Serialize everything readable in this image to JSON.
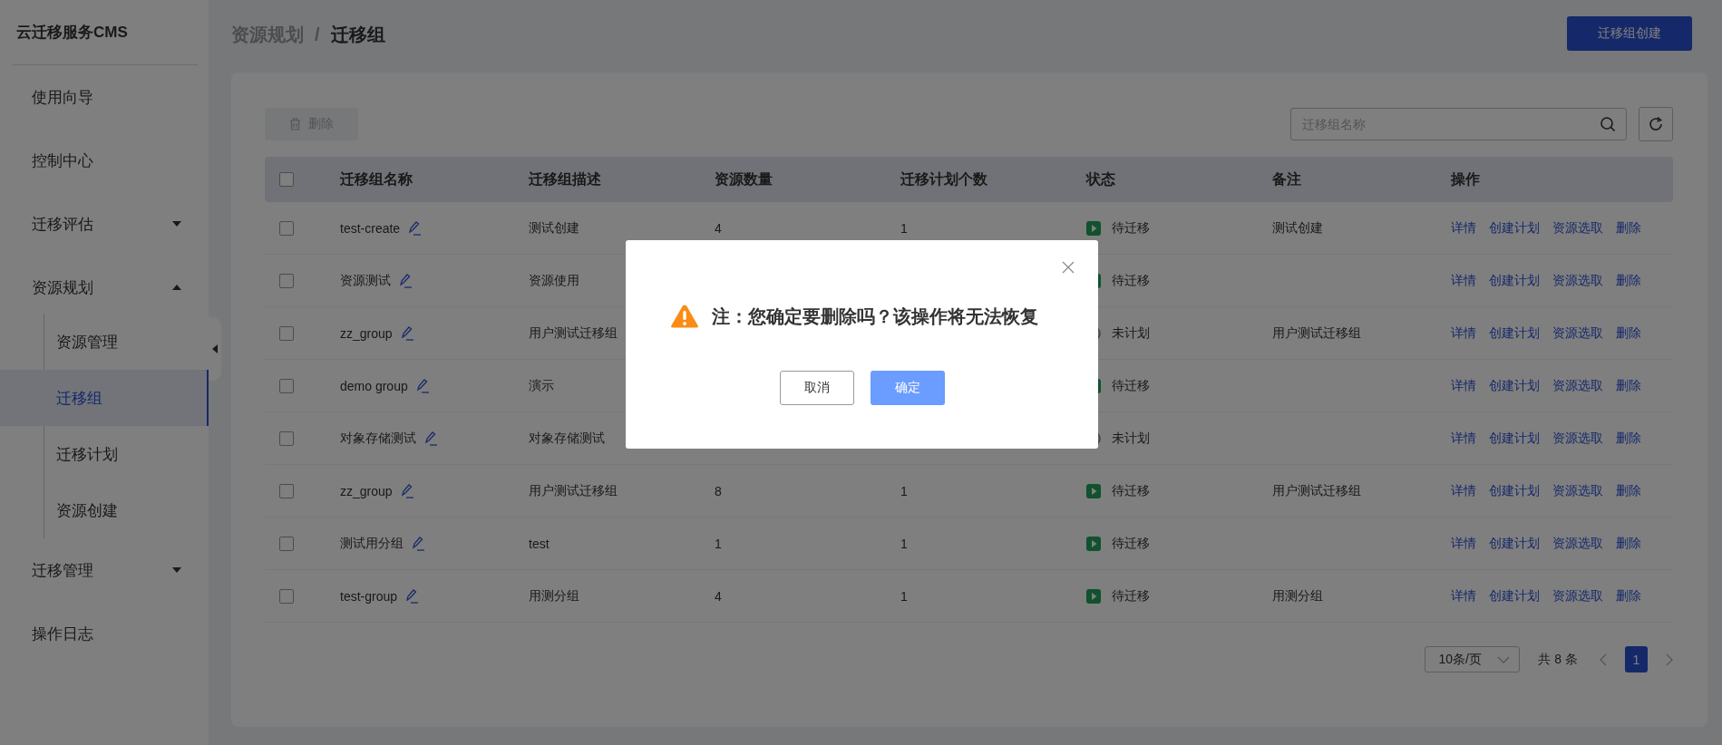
{
  "sidebar": {
    "title": "云迁移服务CMS",
    "items": [
      {
        "label": "使用向导",
        "kind": "item",
        "selected": false
      },
      {
        "label": "控制中心",
        "kind": "item",
        "selected": false
      },
      {
        "label": "迁移评估",
        "kind": "group",
        "expanded": false,
        "selected": false
      },
      {
        "label": "资源规划",
        "kind": "group",
        "expanded": true,
        "selected": false,
        "children": [
          {
            "label": "资源管理",
            "selected": false
          },
          {
            "label": "迁移组",
            "selected": true
          },
          {
            "label": "迁移计划",
            "selected": false
          },
          {
            "label": "资源创建",
            "selected": false
          }
        ]
      },
      {
        "label": "迁移管理",
        "kind": "group",
        "expanded": false,
        "selected": false
      },
      {
        "label": "操作日志",
        "kind": "item",
        "selected": false
      }
    ]
  },
  "breadcrumb": [
    "资源规划",
    "迁移组"
  ],
  "breadcrumb_separator": "/",
  "create_button": "迁移组创建",
  "toolbar": {
    "delete_button": "删除",
    "search": {
      "placeholder": "迁移组名称"
    }
  },
  "table": {
    "header_checked": false,
    "columns": [
      "迁移组名称",
      "迁移组描述",
      "资源数量",
      "迁移计划个数",
      "状态",
      "备注",
      "操作"
    ],
    "rows": [
      {
        "checked": false,
        "name": "test-create",
        "description": "测试创建",
        "resource_count": "4",
        "plan_count": "1",
        "status": {
          "label": "待迁移",
          "kind": "pending"
        },
        "note": "测试创建",
        "actions": [
          "详情",
          "创建计划",
          "资源选取",
          "删除"
        ]
      },
      {
        "checked": false,
        "name": "资源测试",
        "description": "资源使用",
        "status": {
          "label": "待迁移",
          "kind": "pending"
        },
        "actions": [
          "详情",
          "创建计划",
          "资源选取",
          "删除"
        ]
      },
      {
        "checked": false,
        "name": "zz_group",
        "description": "用户测试迁移组",
        "status": {
          "label": "未计划",
          "kind": "unplanned"
        },
        "note": "用户测试迁移组",
        "actions": [
          "详情",
          "创建计划",
          "资源选取",
          "删除"
        ]
      },
      {
        "checked": false,
        "name": "demo group",
        "description": "演示",
        "status": {
          "label": "待迁移",
          "kind": "pending"
        },
        "actions": [
          "详情",
          "创建计划",
          "资源选取",
          "删除"
        ]
      },
      {
        "checked": false,
        "name": "对象存储测试",
        "description": "对象存储测试",
        "status": {
          "label": "未计划",
          "kind": "unplanned"
        },
        "actions": [
          "详情",
          "创建计划",
          "资源选取",
          "删除"
        ]
      },
      {
        "checked": false,
        "name": "zz_group",
        "description": "用户测试迁移组",
        "resource_count": "8",
        "plan_count": "1",
        "status": {
          "label": "待迁移",
          "kind": "pending"
        },
        "note": "用户测试迁移组",
        "actions": [
          "详情",
          "创建计划",
          "资源选取",
          "删除"
        ]
      },
      {
        "checked": false,
        "name": "测试用分组",
        "description": "test",
        "resource_count": "1",
        "plan_count": "1",
        "status": {
          "label": "待迁移",
          "kind": "pending"
        },
        "actions": [
          "详情",
          "创建计划",
          "资源选取",
          "删除"
        ]
      },
      {
        "checked": false,
        "name": "test-group",
        "description": "用测分组",
        "resource_count": "4",
        "plan_count": "1",
        "status": {
          "label": "待迁移",
          "kind": "pending"
        },
        "note": "用测分组",
        "actions": [
          "详情",
          "创建计划",
          "资源选取",
          "删除"
        ]
      }
    ]
  },
  "pagination": {
    "page_size": "10条/页",
    "total": "共 8 条",
    "pages": [
      {
        "label": "1",
        "selected": true
      }
    ]
  },
  "dialog": {
    "message": "注：您确定要删除吗？该操作将无法恢复",
    "buttons": [
      {
        "label": "取消",
        "kind": "secondary"
      },
      {
        "label": "确定",
        "kind": "primary"
      }
    ]
  }
}
